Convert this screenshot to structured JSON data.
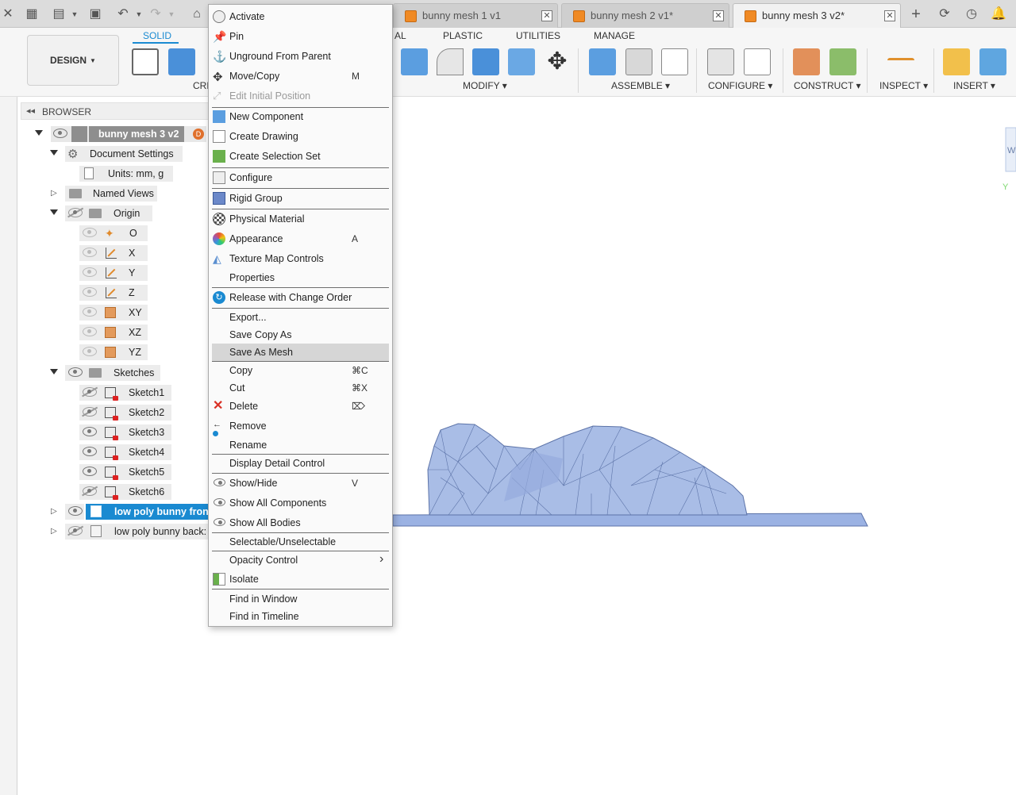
{
  "tabs": [
    {
      "label": "bunny mesh 1 v1",
      "active": false
    },
    {
      "label": "bunny mesh 2 v1*",
      "active": false
    },
    {
      "label": "bunny mesh 3 v2*",
      "active": true
    }
  ],
  "ribbon": {
    "design_label": "DESIGN",
    "workspace_tabs": [
      "SOLID",
      "AL",
      "PLASTIC",
      "UTILITIES",
      "MANAGE"
    ],
    "groups": [
      "CRE",
      "MODIFY",
      "ASSEMBLE",
      "CONFIGURE",
      "CONSTRUCT",
      "INSPECT",
      "INSERT"
    ]
  },
  "browser": {
    "title": "BROWSER",
    "items": [
      {
        "label": "bunny mesh 3 v2"
      },
      {
        "label": "Document Settings"
      },
      {
        "label": "Units: mm, g"
      },
      {
        "label": "Named Views"
      },
      {
        "label": "Origin"
      },
      {
        "label": "O"
      },
      {
        "label": "X"
      },
      {
        "label": "Y"
      },
      {
        "label": "Z"
      },
      {
        "label": "XY"
      },
      {
        "label": "XZ"
      },
      {
        "label": "YZ"
      },
      {
        "label": "Sketches"
      },
      {
        "label": "Sketch1"
      },
      {
        "label": "Sketch2"
      },
      {
        "label": "Sketch3"
      },
      {
        "label": "Sketch4"
      },
      {
        "label": "Sketch5"
      },
      {
        "label": "Sketch6"
      },
      {
        "label": "low poly bunny fron"
      },
      {
        "label": "low poly bunny back:"
      }
    ]
  },
  "context_menu": {
    "items": [
      {
        "label": "Activate",
        "shortcut": ""
      },
      {
        "label": "Pin",
        "shortcut": ""
      },
      {
        "label": "Unground From Parent",
        "shortcut": ""
      },
      {
        "label": "Move/Copy",
        "shortcut": "M"
      },
      {
        "label": "Edit Initial Position",
        "shortcut": ""
      },
      {
        "label": "New Component",
        "shortcut": ""
      },
      {
        "label": "Create Drawing",
        "shortcut": ""
      },
      {
        "label": "Create Selection Set",
        "shortcut": ""
      },
      {
        "label": "Configure",
        "shortcut": ""
      },
      {
        "label": "Rigid Group",
        "shortcut": ""
      },
      {
        "label": "Physical Material",
        "shortcut": ""
      },
      {
        "label": "Appearance",
        "shortcut": "A"
      },
      {
        "label": "Texture Map Controls",
        "shortcut": ""
      },
      {
        "label": "Properties",
        "shortcut": ""
      },
      {
        "label": "Release with Change Order",
        "shortcut": ""
      },
      {
        "label": "Export...",
        "shortcut": ""
      },
      {
        "label": "Save Copy As",
        "shortcut": ""
      },
      {
        "label": "Save As Mesh",
        "shortcut": ""
      },
      {
        "label": "Copy",
        "shortcut": "⌘C"
      },
      {
        "label": "Cut",
        "shortcut": "⌘X"
      },
      {
        "label": "Delete",
        "shortcut": "⌦"
      },
      {
        "label": "Remove",
        "shortcut": ""
      },
      {
        "label": "Rename",
        "shortcut": ""
      },
      {
        "label": "Display Detail Control",
        "shortcut": ""
      },
      {
        "label": "Show/Hide",
        "shortcut": "V"
      },
      {
        "label": "Show All Components",
        "shortcut": ""
      },
      {
        "label": "Show All Bodies",
        "shortcut": ""
      },
      {
        "label": "Selectable/Unselectable",
        "shortcut": ""
      },
      {
        "label": "Opacity Control",
        "shortcut": ""
      },
      {
        "label": "Isolate",
        "shortcut": ""
      },
      {
        "label": "Find in Window",
        "shortcut": ""
      },
      {
        "label": "Find in Timeline",
        "shortcut": ""
      }
    ]
  },
  "colors": {
    "accent": "#1a8ad1",
    "selection": "#1a8ad1",
    "mesh_fill": "#a9bde6",
    "mesh_edge": "#5c73a8",
    "highlight": "#d6d6d6"
  }
}
